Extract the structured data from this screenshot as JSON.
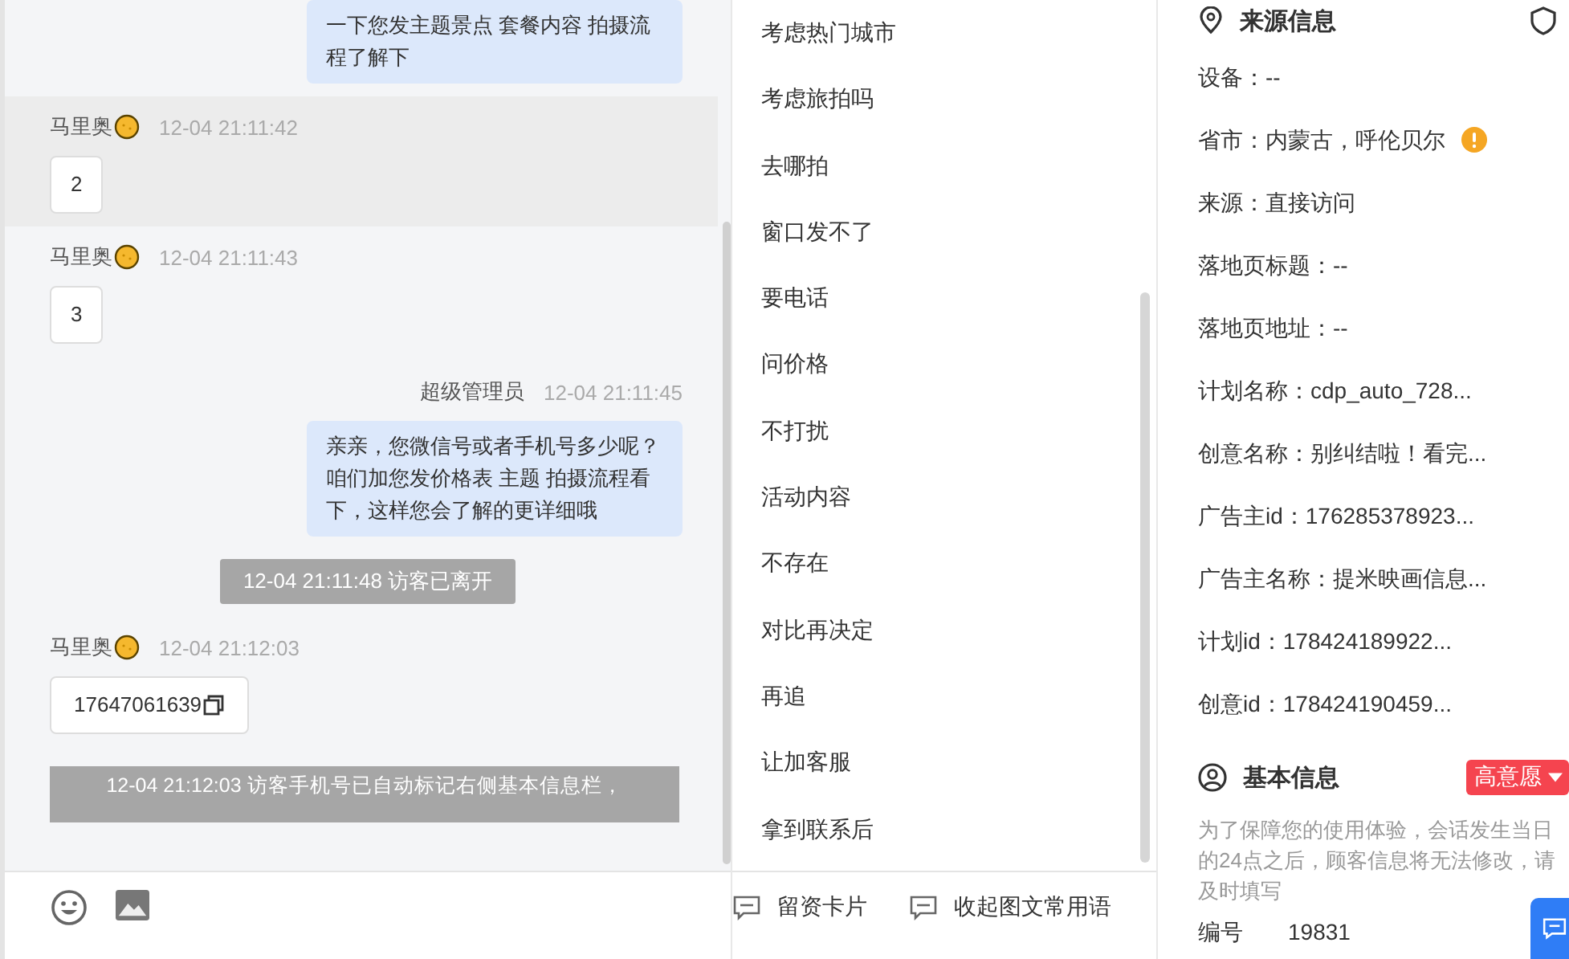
{
  "chat": {
    "messages": [
      {
        "kind": "agent_bubble",
        "text": "一下您发主题景点 套餐内容 拍摄流程了解下"
      },
      {
        "kind": "visitor",
        "name": "马里奥",
        "time": "12-04 21:11:42",
        "text": "2",
        "highlighted": true
      },
      {
        "kind": "visitor",
        "name": "马里奥",
        "time": "12-04 21:11:43",
        "text": "3",
        "highlighted": false
      },
      {
        "kind": "agent",
        "name": "超级管理员",
        "time": "12-04 21:11:45",
        "text": "亲亲，您微信号或者手机号多少呢？咱们加您发价格表 主题 拍摄流程看下，这样您会了解的更详细哦"
      },
      {
        "kind": "system",
        "text": "12-04 21:11:48 访客已离开"
      },
      {
        "kind": "visitor_phone",
        "name": "马里奥",
        "time": "12-04 21:12:03",
        "text": "17647061639",
        "highlighted": false
      },
      {
        "kind": "notice",
        "text": "12-04 21:12:03 访客手机号已自动标记右侧基本信息栏，"
      }
    ]
  },
  "quick_replies": {
    "items": [
      "考虑热门城市",
      "考虑旅拍吗",
      "去哪拍",
      "窗口发不了",
      "要电话",
      "问价格",
      "不打扰",
      "活动内容",
      "不存在",
      "对比再决定",
      "再追",
      "让加客服",
      "拿到联系后"
    ]
  },
  "footer_actions": [
    "留资卡片",
    "收起图文常用语"
  ],
  "source_info": {
    "title": "来源信息",
    "fields": [
      {
        "text": "设备：--",
        "warning": false
      },
      {
        "text": "省市：内蒙古，呼伦贝尔",
        "warning": true
      },
      {
        "text": "来源：直接访问",
        "warning": false
      },
      {
        "text": "落地页标题：--",
        "warning": false
      },
      {
        "text": "落地页地址：--",
        "warning": false
      },
      {
        "text": "计划名称：cdp_auto_728...",
        "warning": false
      },
      {
        "text": "创意名称：别纠结啦！看完...",
        "warning": false
      },
      {
        "text": "广告主id：176285378923...",
        "warning": false
      },
      {
        "text": "广告主名称：提米映画信息...",
        "warning": false
      },
      {
        "text": "计划id：178424189922...",
        "warning": false
      },
      {
        "text": "创意id：178424190459...",
        "warning": false
      }
    ]
  },
  "basic_info": {
    "title": "基本信息",
    "intent_tag": "高意愿",
    "note": "为了保障您的使用体验，会话发生当日的24点之后，顾客信息将无法修改，请及时填写",
    "fields": [
      {
        "label": "编号",
        "value": "19831"
      }
    ]
  }
}
